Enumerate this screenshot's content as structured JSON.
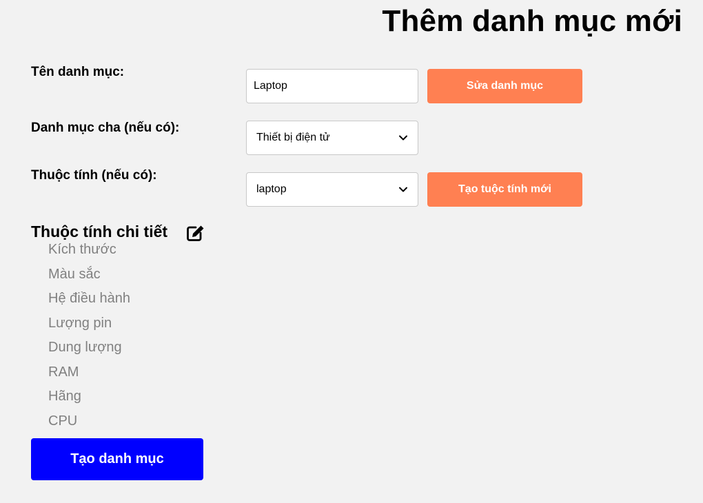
{
  "page": {
    "title": "Thêm danh mục mới"
  },
  "form": {
    "name_label": "Tên danh mục:",
    "name_value": "Laptop",
    "edit_category_label": "Sửa danh mục",
    "parent_label": "Danh mục cha (nếu có):",
    "parent_selected": "Thiết bị điện tử",
    "attribute_label": "Thuộc tính (nếu có):",
    "attribute_selected": "laptop",
    "create_attribute_label": "Tạo tuộc tính mới"
  },
  "details": {
    "heading": "Thuộc tính chi tiết",
    "edit_icon": "edit-square-icon",
    "items": [
      "Kích thước",
      "Màu sắc",
      "Hệ điều hành",
      "Lượng pin",
      "Dung lượng",
      "RAM",
      "Hãng",
      "CPU"
    ]
  },
  "actions": {
    "create_label": "Tạo danh mục"
  },
  "colors": {
    "background": "#f2f2f2",
    "accent_orange": "#ff8052",
    "primary_blue": "#0000ff",
    "muted_text": "#808080"
  }
}
